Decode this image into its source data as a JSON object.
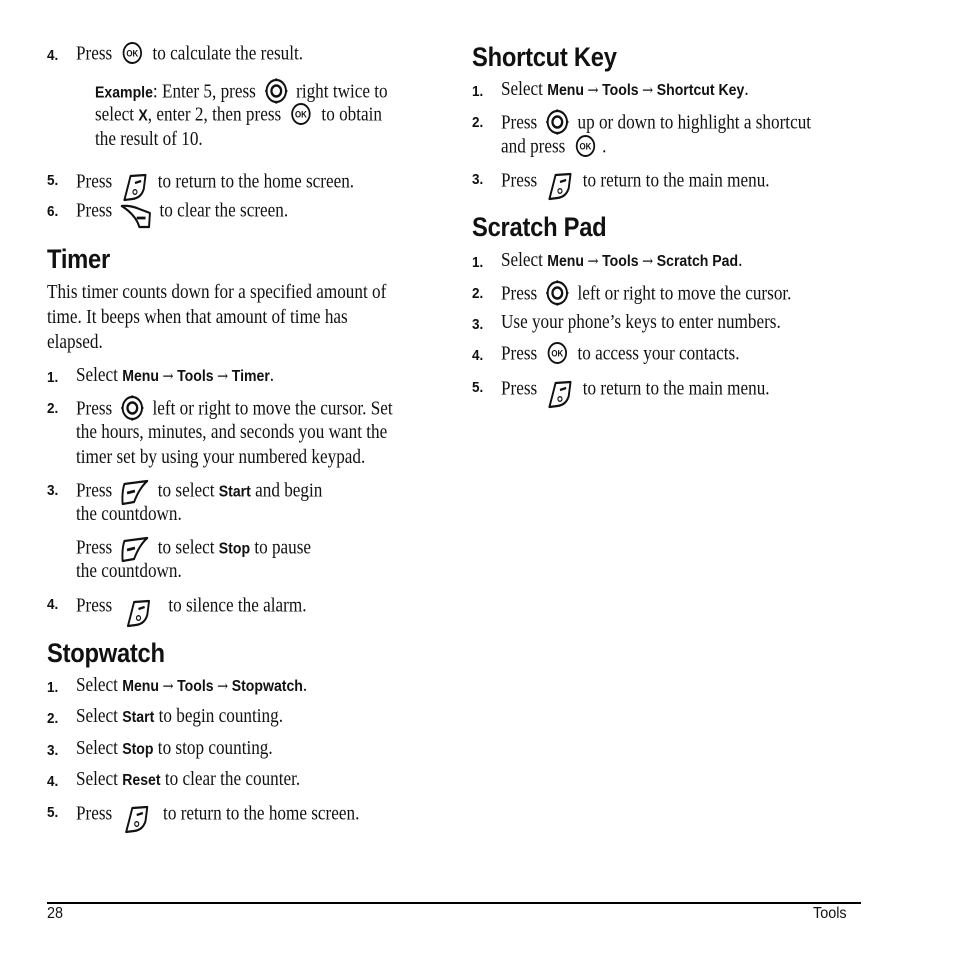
{
  "page": {
    "number": "28",
    "section_footer": "Tools"
  },
  "icons": {
    "ok": "ok-key-icon",
    "nav": "navigation-key-icon",
    "end": "end-key-icon",
    "clear": "clear-key-icon",
    "left_softkey": "left-softkey-icon"
  },
  "calc": {
    "step4": {
      "num": "4.",
      "pre": "Press",
      "post": "to calculate the result."
    },
    "example": {
      "label": "Example",
      "l1a": ": Enter 5, press",
      "l1b": "right twice to",
      "l2a": "select ",
      "l2x": "X",
      "l2b": ", enter 2, then press",
      "l2c": "to obtain",
      "l3": "the result of 10."
    },
    "step5": {
      "num": "5.",
      "pre": "Press",
      "post": "to return to the home screen."
    },
    "step6": {
      "num": "6.",
      "pre": "Press",
      "post": "to clear the screen."
    }
  },
  "timer": {
    "title": "Timer",
    "intro": [
      "This timer counts down for a specified amount of",
      "time. It beeps when that amount of time has",
      "elapsed."
    ],
    "menu": {
      "num": "1.",
      "pre": "Select",
      "path": [
        "Menu",
        "Tools",
        "Timer"
      ],
      "arrow": "→"
    },
    "step2": {
      "num": "2.",
      "pre": "Press",
      "l1": "left or right to move the cursor. Set",
      "l2": "the hours, minutes, and seconds you want the",
      "l3": "timer set by using your numbered keypad."
    },
    "step3": {
      "num": "3.",
      "pre": "Press",
      "l1a": "to select ",
      "l1b": "Start",
      "l1c": " and begin",
      "l2": "the countdown."
    },
    "step3b": {
      "pre": "Press",
      "l1a": "to select ",
      "l1b": "Stop",
      "l1c": " to pause",
      "l2": "the countdown."
    },
    "step4": {
      "num": "4.",
      "pre": "Press",
      "post": "to silence the alarm."
    }
  },
  "stopwatch": {
    "title": "Stopwatch",
    "menu": {
      "num": "1.",
      "pre": "Select",
      "path": [
        "Menu",
        "Tools",
        "Stopwatch"
      ],
      "arrow": "→"
    },
    "step2": {
      "num": "2.",
      "pre": "Select ",
      "bold": "Start",
      "post": " to begin counting."
    },
    "step3": {
      "num": "3.",
      "pre": "Select ",
      "bold": "Stop",
      "post": " to stop counting."
    },
    "step4": {
      "num": "4.",
      "pre": "Select ",
      "bold": "Reset",
      "post": " to clear the counter."
    },
    "step5": {
      "num": "5.",
      "pre": "Press",
      "post": "to return to the home screen."
    }
  },
  "shortcut": {
    "title": "Shortcut Key",
    "menu": {
      "num": "1.",
      "pre": "Select",
      "path": [
        "Menu",
        "Tools",
        "Shortcut Key"
      ],
      "arrow": "→"
    },
    "step2": {
      "num": "2.",
      "pre": "Press",
      "l1": "up or down to highlight a shortcut",
      "l2a": "and press",
      "l2b": "."
    },
    "step3": {
      "num": "3.",
      "pre": "Press",
      "post": "to return to the main menu."
    }
  },
  "scratch": {
    "title": "Scratch Pad",
    "menu": {
      "num": "1.",
      "pre": "Select",
      "path": [
        "Menu",
        "Tools",
        "Scratch Pad"
      ],
      "arrow": "→"
    },
    "step2": {
      "num": "2.",
      "pre": "Press",
      "post": "left or right to move the cursor."
    },
    "step3": {
      "num": "3.",
      "text": "Use your phone’s keys to enter numbers."
    },
    "step4": {
      "num": "4.",
      "pre": "Press",
      "post": "to access your contacts."
    },
    "step5": {
      "num": "5.",
      "pre": "Press",
      "post": "to return to the main menu."
    }
  }
}
